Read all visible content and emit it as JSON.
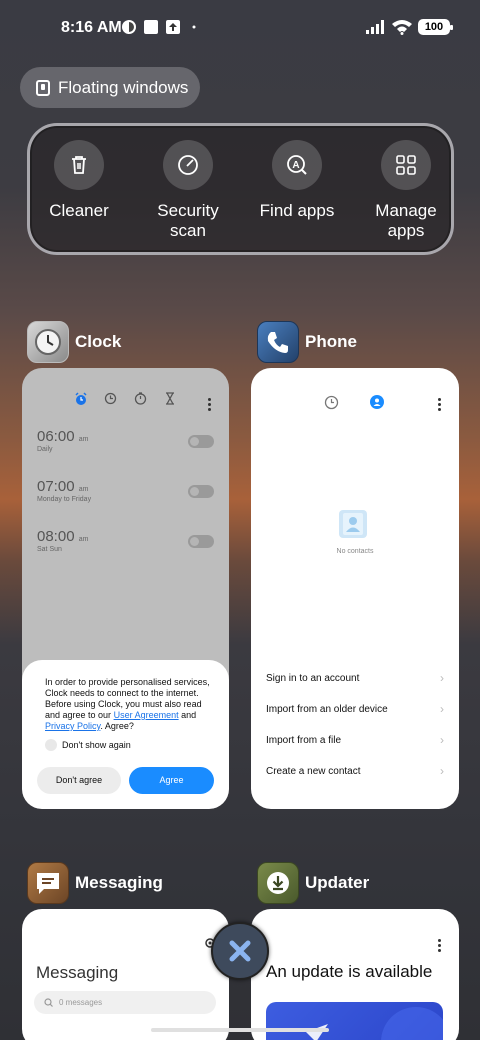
{
  "status_bar": {
    "time": "8:16 AM",
    "battery": "100"
  },
  "floating_windows": {
    "label": "Floating windows"
  },
  "quick_actions": [
    {
      "label": "Cleaner",
      "icon": "trash-icon"
    },
    {
      "label": "Security scan",
      "icon": "security-scan-icon"
    },
    {
      "label": "Find apps",
      "icon": "find-apps-icon"
    },
    {
      "label": "Manage apps",
      "icon": "grid-icon"
    }
  ],
  "apps": {
    "clock": {
      "name": "Clock",
      "alarms": [
        {
          "time": "06:00",
          "ampm": "am",
          "sub": "Daily"
        },
        {
          "time": "07:00",
          "ampm": "am",
          "sub": "Monday to Friday"
        },
        {
          "time": "08:00",
          "ampm": "am",
          "sub": "Sat Sun"
        }
      ],
      "dialog": {
        "text": "In order to provide personalised services, Clock needs to connect to the internet. Before using Clock, you must also read and agree to our",
        "link1": "User Agreement",
        "and": "and",
        "link2": "Privacy Policy",
        "end": ". Agree?",
        "checkbox": "Don't show again",
        "decline": "Don't agree",
        "accept": "Agree"
      }
    },
    "phone": {
      "name": "Phone",
      "empty": "No contacts",
      "rows": [
        "Sign in to an account",
        "Import from an older device",
        "Import from a file",
        "Create a new contact"
      ]
    },
    "messaging": {
      "name": "Messaging",
      "title": "Messaging",
      "search": "0 messages"
    },
    "updater": {
      "name": "Updater",
      "title": "An update is available"
    }
  },
  "colors": {
    "accent": "#1a8cff",
    "clock_tab": "#1a73e8"
  }
}
